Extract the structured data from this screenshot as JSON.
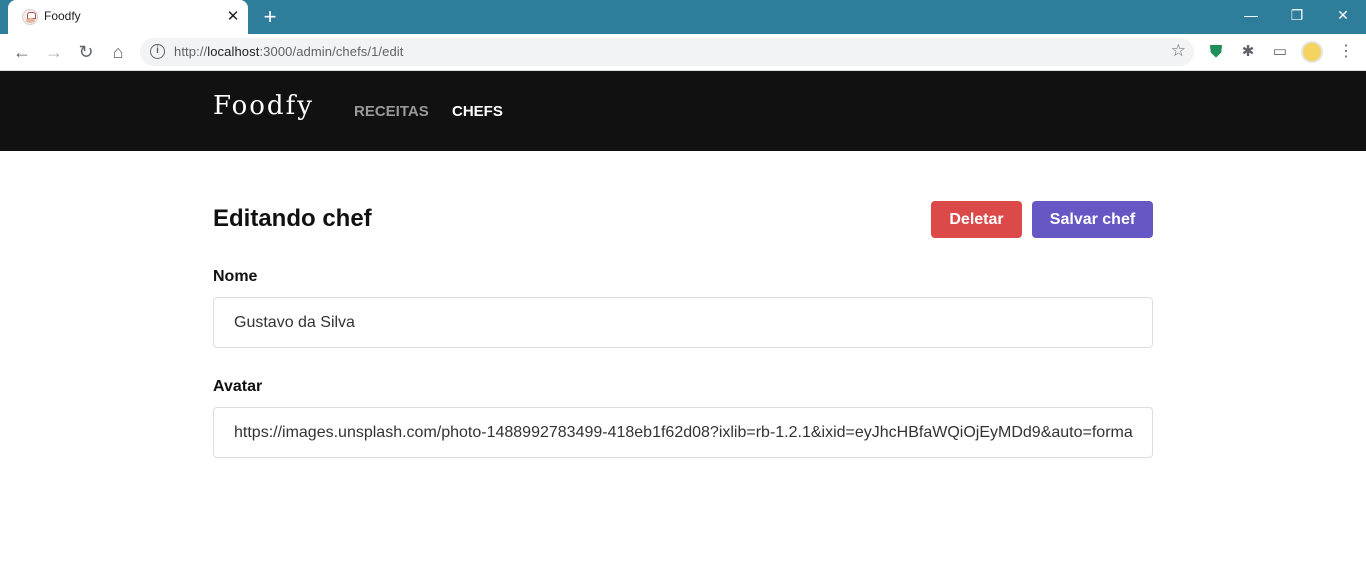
{
  "browser": {
    "tab": {
      "title": "Foodfy",
      "close_icon": "close-icon",
      "favicon": "chef-favicon-icon"
    },
    "newtab_label": "+",
    "window_controls": {
      "minimize": "—",
      "restore": "❐",
      "close": "✕"
    },
    "nav": {
      "back": "←",
      "forward": "→",
      "reload": "↻",
      "home": "⌂"
    },
    "address": {
      "scheme": "http://",
      "host": "localhost",
      "path": ":3000/admin/chefs/1/edit"
    },
    "colors": {
      "tabbar": "#2e7d9b",
      "omnibox": "#f1f3f4"
    }
  },
  "header": {
    "logo": "Foodfy",
    "nav": [
      {
        "label": "Receitas",
        "active": false
      },
      {
        "label": "Chefs",
        "active": true
      }
    ],
    "colors": {
      "background": "#111111",
      "active": "#ffffff",
      "inactive": "#999999"
    }
  },
  "main": {
    "title": "Editando chef",
    "buttons": {
      "delete": "Deletar",
      "save": "Salvar chef"
    },
    "colors": {
      "delete": "#dc4949",
      "save": "#6558c5"
    },
    "fields": {
      "name": {
        "label": "Nome",
        "value": "Gustavo da Silva"
      },
      "avatar": {
        "label": "Avatar",
        "value": "https://images.unsplash.com/photo-1488992783499-418eb1f62d08?ixlib=rb-1.2.1&ixid=eyJhcHBfaWQiOjEyMDd9&auto=forma"
      }
    }
  }
}
